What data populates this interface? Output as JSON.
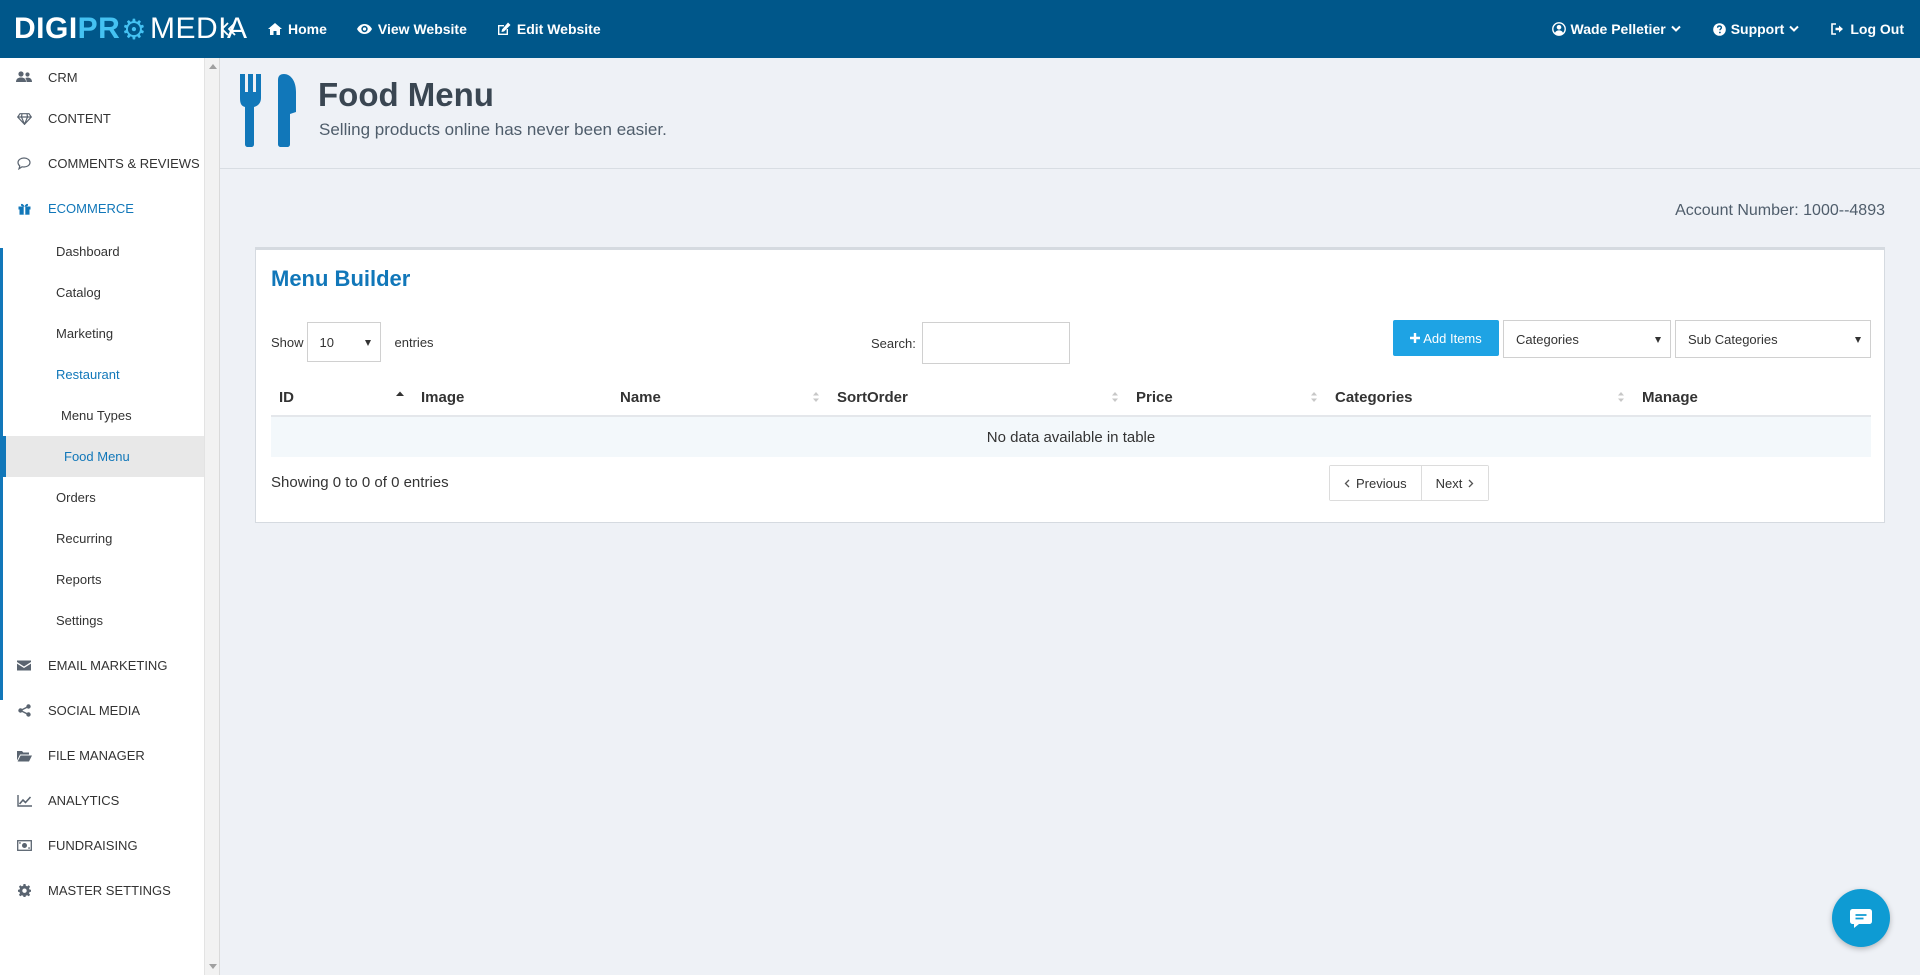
{
  "topbar": {
    "logo": {
      "part1": "DIGI",
      "part2": "PR",
      "part3": "MEDIA"
    },
    "nav": [
      {
        "label": "Home",
        "icon": "home-icon"
      },
      {
        "label": "View Website",
        "icon": "eye-icon"
      },
      {
        "label": "Edit Website",
        "icon": "edit-icon"
      }
    ],
    "user": {
      "label": "Wade Pelletier",
      "icon": "user-circle-icon"
    },
    "support": {
      "label": "Support",
      "icon": "question-circle-icon"
    },
    "logout": {
      "label": "Log Out",
      "icon": "sign-out-icon"
    },
    "colors": {
      "background": "#00578a",
      "logo_accent": "#44c2f2"
    }
  },
  "sidebar": {
    "items": [
      {
        "label": "CRM",
        "icon": "users-icon"
      },
      {
        "label": "CONTENT",
        "icon": "diamond-icon"
      },
      {
        "label": "COMMENTS & REVIEWS",
        "icon": "comment-icon"
      },
      {
        "label": "ECOMMERCE",
        "icon": "gift-icon",
        "active": true
      },
      {
        "label": "EMAIL MARKETING",
        "icon": "envelope-icon"
      },
      {
        "label": "SOCIAL MEDIA",
        "icon": "share-icon"
      },
      {
        "label": "FILE MANAGER",
        "icon": "folder-open-icon"
      },
      {
        "label": "ANALYTICS",
        "icon": "line-chart-icon"
      },
      {
        "label": "FUNDRAISING",
        "icon": "money-icon"
      },
      {
        "label": "MASTER SETTINGS",
        "icon": "gear-icon"
      }
    ],
    "ecommerce_sub": [
      {
        "label": "Dashboard"
      },
      {
        "label": "Catalog"
      },
      {
        "label": "Marketing"
      },
      {
        "label": "Restaurant",
        "active": true
      },
      {
        "label": "Menu Types"
      },
      {
        "label": "Food Menu",
        "current": true
      },
      {
        "label": "Orders"
      },
      {
        "label": "Recurring"
      },
      {
        "label": "Reports"
      },
      {
        "label": "Settings"
      }
    ],
    "accent": "#1177b9"
  },
  "page": {
    "title": "Food Menu",
    "subtitle": "Selling products online has never been easier.",
    "icon": "cutlery-icon",
    "account_number": "Account Number: 1000--4893"
  },
  "card": {
    "title": "Menu Builder",
    "show_label": "Show",
    "entries_value": "10",
    "entries_label": "entries",
    "search_label": "Search:",
    "search_value": "",
    "add_button": "Add Items",
    "categories_select": "Categories",
    "subcategories_select": "Sub Categories",
    "columns": [
      "ID",
      "Image",
      "Name",
      "SortOrder",
      "Price",
      "Categories",
      "Manage"
    ],
    "empty_message": "No data available in table",
    "info": "Showing 0 to 0 of 0 entries",
    "pager": {
      "previous": "Previous",
      "next": "Next"
    },
    "accent": "#1ea3e4"
  },
  "chat": {
    "icon": "chat-bubble-icon",
    "color": "#0e9bd3"
  }
}
